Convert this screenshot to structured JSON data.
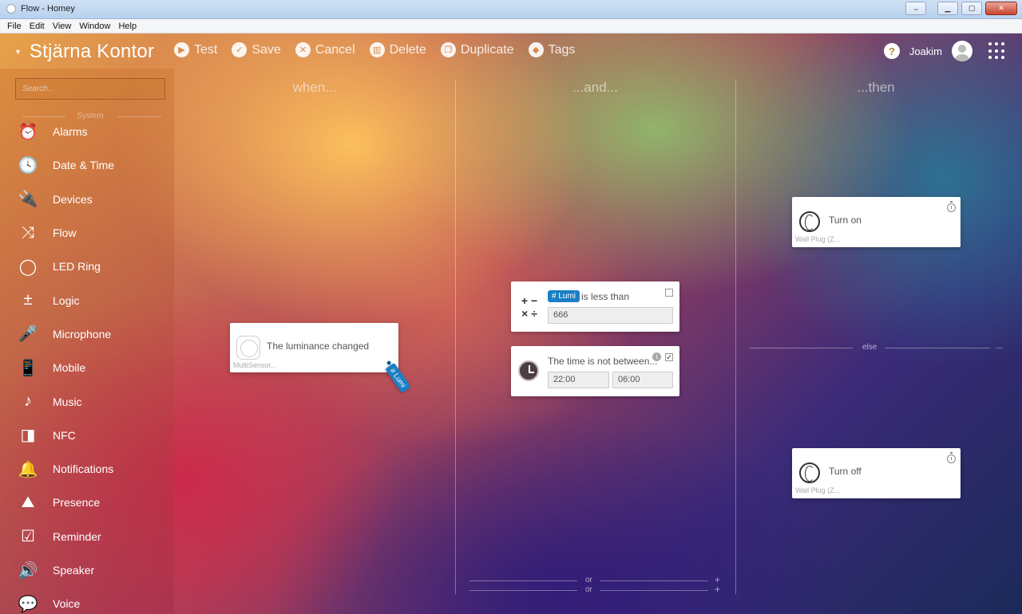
{
  "window": {
    "title": "Flow - Homey"
  },
  "menu": [
    "File",
    "Edit",
    "View",
    "Window",
    "Help"
  ],
  "toolbar": {
    "flow_name": "Stjärna Kontor",
    "actions": [
      {
        "label": "Test",
        "icon": "play-icon"
      },
      {
        "label": "Save",
        "icon": "check-icon"
      },
      {
        "label": "Cancel",
        "icon": "cancel-icon"
      },
      {
        "label": "Delete",
        "icon": "trash-icon"
      },
      {
        "label": "Duplicate",
        "icon": "duplicate-icon"
      },
      {
        "label": "Tags",
        "icon": "tag-icon"
      }
    ],
    "help": "?",
    "user": "Joakim"
  },
  "sidebar": {
    "search_placeholder": "Search...",
    "section": "System",
    "items": [
      {
        "label": "Alarms",
        "icon": "alarm-clock-icon",
        "glyph": "⏰"
      },
      {
        "label": "Date & Time",
        "icon": "clock-icon",
        "glyph": "🕓"
      },
      {
        "label": "Devices",
        "icon": "plug-icon",
        "glyph": "🔌"
      },
      {
        "label": "Flow",
        "icon": "flow-icon",
        "glyph": "⤨"
      },
      {
        "label": "LED Ring",
        "icon": "led-ring-icon",
        "glyph": "◯"
      },
      {
        "label": "Logic",
        "icon": "logic-icon",
        "glyph": "±"
      },
      {
        "label": "Microphone",
        "icon": "microphone-icon",
        "glyph": "🎤"
      },
      {
        "label": "Mobile",
        "icon": "mobile-icon",
        "glyph": "📱"
      },
      {
        "label": "Music",
        "icon": "music-note-icon",
        "glyph": "♪"
      },
      {
        "label": "NFC",
        "icon": "nfc-icon",
        "glyph": "◨"
      },
      {
        "label": "Notifications",
        "icon": "bell-icon",
        "glyph": "🔔"
      },
      {
        "label": "Presence",
        "icon": "presence-icon",
        "glyph": "⛰"
      },
      {
        "label": "Reminder",
        "icon": "reminder-icon",
        "glyph": "☑"
      },
      {
        "label": "Speaker",
        "icon": "speaker-icon",
        "glyph": "🔊"
      },
      {
        "label": "Voice",
        "icon": "voice-icon",
        "glyph": "💬"
      }
    ]
  },
  "columns": {
    "when": "when...",
    "and": "...and...",
    "then": "...then"
  },
  "canvas": {
    "or": "or",
    "else": "else",
    "plus": "+"
  },
  "when_card": {
    "title": "The luminance changed",
    "device": "MultiSensor...",
    "token": "# Lumi"
  },
  "and_cards": {
    "logic": {
      "tag": "# Lumi",
      "text": "is less than",
      "value": "666"
    },
    "time": {
      "title": "The time is not between...",
      "from": "22:00",
      "to": "06:00",
      "checked": true
    }
  },
  "then_cards": {
    "on": {
      "title": "Turn on",
      "device": "Wall Plug (Z..."
    },
    "off": {
      "title": "Turn off",
      "device": "Wall Plug (Z..."
    }
  }
}
